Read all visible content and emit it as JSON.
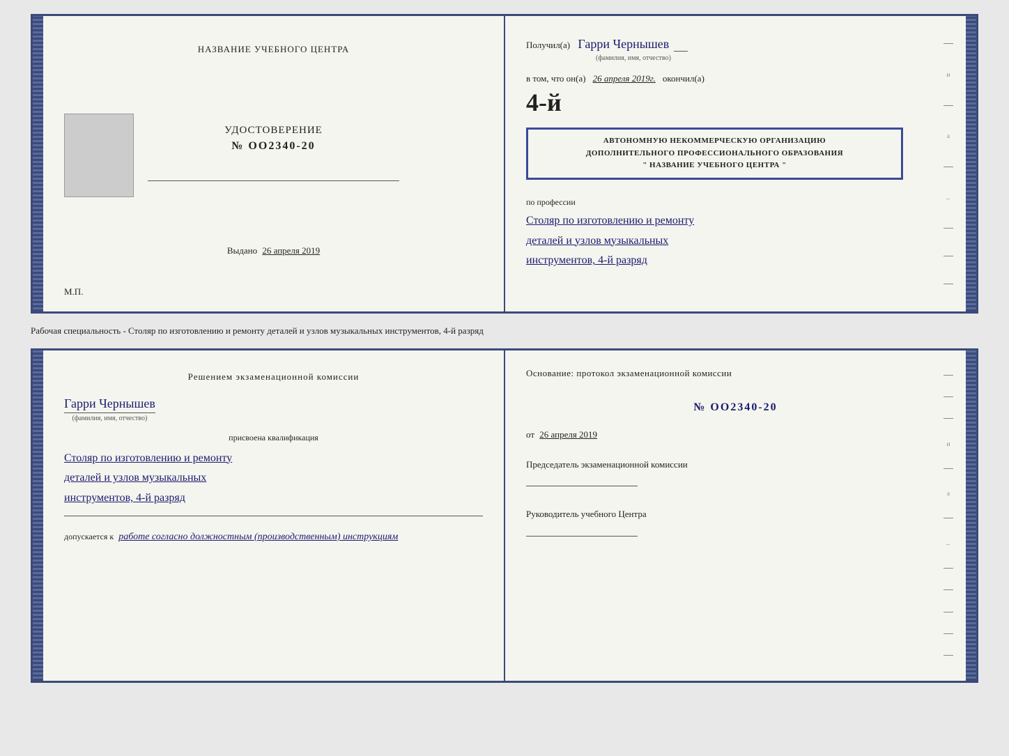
{
  "page": {
    "background": "#e8e8e8"
  },
  "caption": "Рабочая специальность - Столяр по изготовлению и ремонту деталей и узлов музыкальных инструментов, 4-й разряд",
  "top_doc": {
    "left": {
      "org_title": "НАЗВАНИЕ УЧЕБНОГО ЦЕНТРА",
      "cert_label": "УДОСТОВЕРЕНИЕ",
      "cert_number": "№ OO2340-20",
      "issued_label": "Выдано",
      "issued_date": "26 апреля 2019",
      "mp_label": "М.П."
    },
    "right": {
      "received_label": "Получил(а)",
      "recipient_name": "Гарри Чернышев",
      "name_sublabel": "(фамилия, имя, отчество)",
      "vtom_label": "в том, что он(а)",
      "date_label": "26 апреля 2019г.",
      "finished_label": "окончил(а)",
      "grade_big": "4-й",
      "stamp_line1": "АВТОНОМНУЮ НЕКОММЕРЧЕСКУЮ ОРГАНИЗАЦИЮ",
      "stamp_line2": "ДОПОЛНИТЕЛЬНОГО ПРОФЕССИОНАЛЬНОГО ОБРАЗОВАНИЯ",
      "stamp_line3": "\" НАЗВАНИЕ УЧЕБНОГО ЦЕНТРА \"",
      "profession_label": "по профессии",
      "profession_line1": "Столяр по изготовлению и ремонту",
      "profession_line2": "деталей и узлов музыкальных",
      "profession_line3": "инструментов, 4-й разряд"
    }
  },
  "bottom_doc": {
    "left": {
      "decision_title": "Решением экзаменационной комиссии",
      "person_name": "Гарри Чернышев",
      "name_sublabel": "(фамилия, имя, отчество)",
      "assigned_label": "присвоена квалификация",
      "qual_line1": "Столяр по изготовлению и ремонту",
      "qual_line2": "деталей и узлов музыкальных",
      "qual_line3": "инструментов, 4-й разряд",
      "admitted_label": "допускается к",
      "admitted_text": "работе согласно должностным (производственным) инструкциям"
    },
    "right": {
      "basis_label": "Основание: протокол экзаменационной комиссии",
      "protocol_number": "№  OO2340-20",
      "date_prefix": "от",
      "date_value": "26 апреля 2019",
      "chair_label": "Председатель экзаменационной комиссии",
      "head_label": "Руководитель учебного Центра"
    }
  }
}
